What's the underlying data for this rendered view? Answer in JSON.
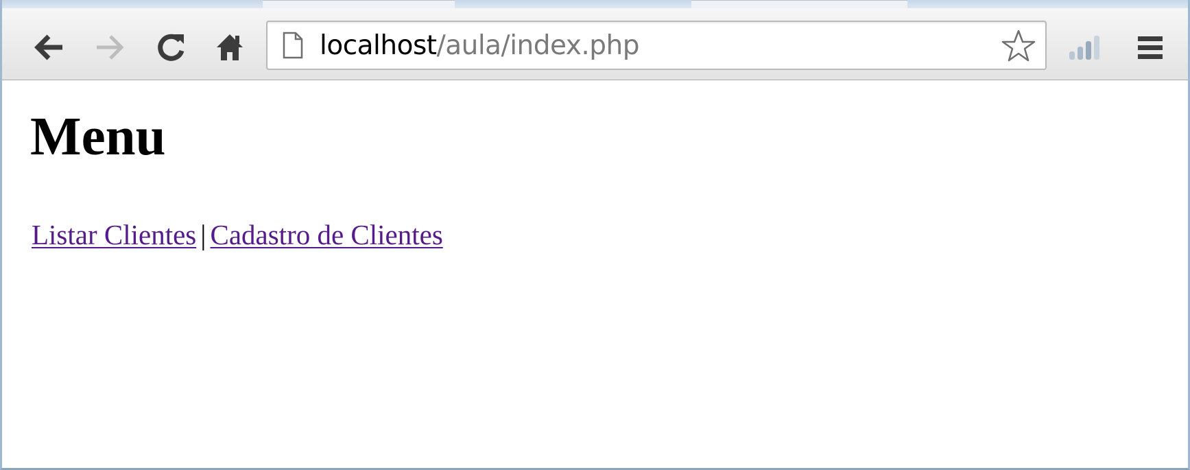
{
  "browser": {
    "address_bar": {
      "host": "localhost",
      "path": "/aula/index.php"
    },
    "icons": {
      "back": "back-arrow-icon",
      "forward": "forward-arrow-icon",
      "reload": "reload-icon",
      "home": "home-icon",
      "page": "page-icon",
      "bookmark": "star-icon",
      "extension": "signal-bars-icon",
      "menu": "hamburger-menu-icon"
    }
  },
  "page": {
    "title": "Menu",
    "nav": {
      "link1": "Listar Clientes",
      "separator": "|",
      "link2": "Cadastro de Clientes"
    }
  },
  "colors": {
    "visited_link": "#551a8b",
    "url_path": "#7a7a7a"
  }
}
